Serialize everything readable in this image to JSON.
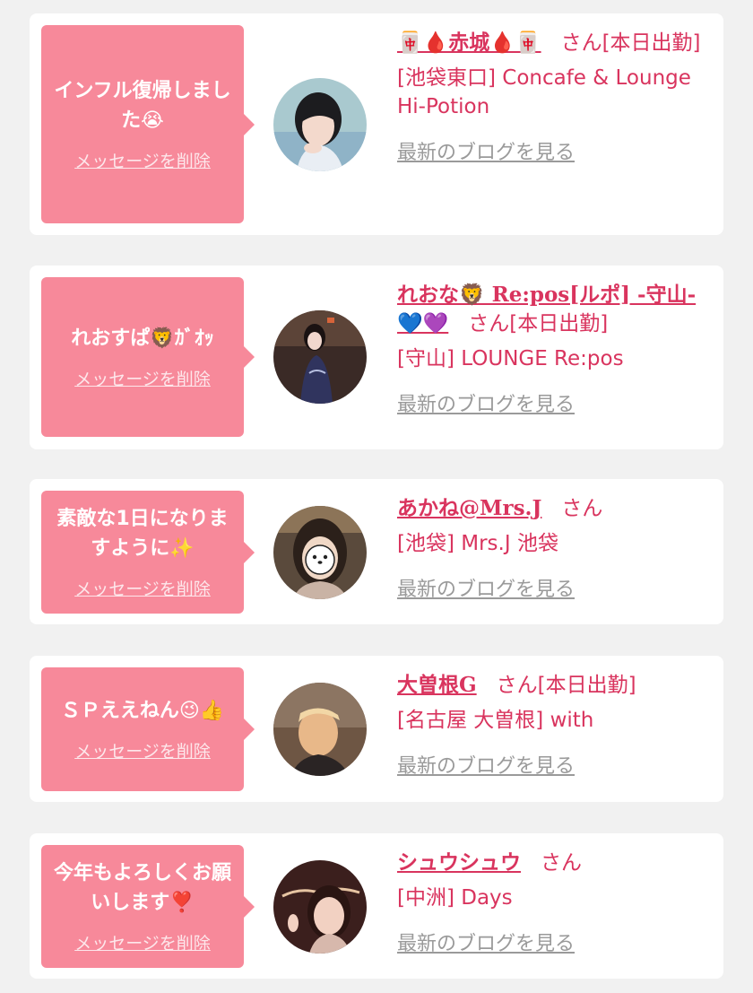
{
  "colors": {
    "background": "#f1f1f1",
    "card": "#ffffff",
    "bubble": "#f7899a",
    "accent_text": "#d9345e",
    "link_gray": "#9a9a9a"
  },
  "icons": [
    "mahjong-tile-icon",
    "blood-drop-icon",
    "lion-face-icon",
    "blue-heart-icon",
    "purple-heart-icon",
    "sparkles-icon",
    "wink-face-icon",
    "thumbs-up-icon",
    "exclamation-heart-icon",
    "crying-face-icon"
  ],
  "items": [
    {
      "bubble": "インフル復帰しました😭",
      "delete": "メッセージを削除",
      "name": "🀄🩸赤城🩸🀄",
      "san": "さん",
      "status": "[本日出勤]",
      "shop": "[池袋東口] Concafe & Lounge Hi-Potion",
      "blog": "最新のブログを見る"
    },
    {
      "bubble": "れおすぱ🦁ｶﾞｵｯ",
      "delete": "メッセージを削除",
      "name": "れおな🦁 Re:pos[ルポ] -守山-💙💜",
      "san": "さん",
      "status": "[本日出勤]",
      "shop": "[守山] LOUNGE Re:pos",
      "blog": "最新のブログを見る"
    },
    {
      "bubble": "素敵な1日になりますように✨",
      "delete": "メッセージを削除",
      "name": "あかね@Mrs.J",
      "san": "さん",
      "status": "",
      "shop": "[池袋] Mrs.J 池袋",
      "blog": "最新のブログを見る"
    },
    {
      "bubble": "ＳＰええねん😉👍",
      "delete": "メッセージを削除",
      "name": "大曽根G",
      "san": "さん",
      "status": "[本日出勤]",
      "shop": "[名古屋 大曽根] with",
      "blog": "最新のブログを見る"
    },
    {
      "bubble": "今年もよろしくお願いします❣️",
      "delete": "メッセージを削除",
      "name": "シュウシュウ",
      "san": "さん",
      "status": "",
      "shop": "[中洲] Days",
      "blog": "最新のブログを見る"
    }
  ]
}
